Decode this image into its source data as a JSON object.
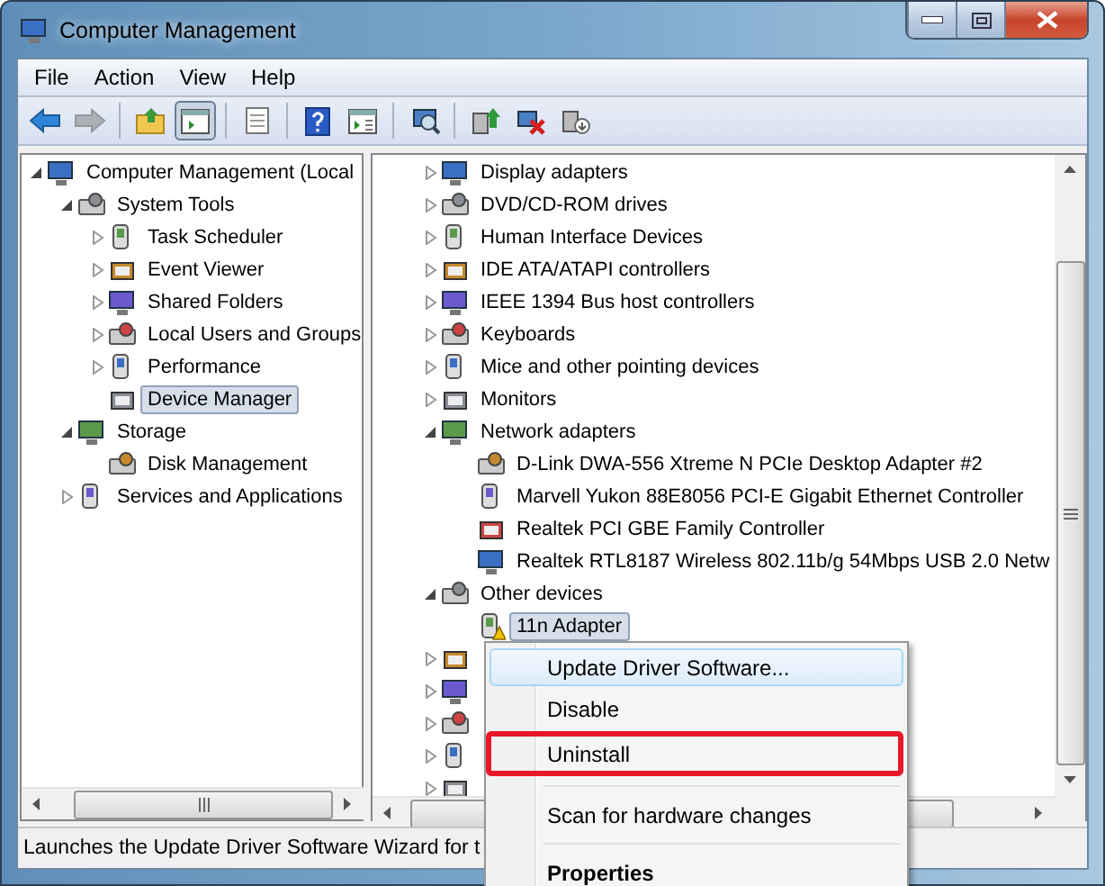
{
  "window": {
    "title": "Computer Management"
  },
  "menu_bar": [
    "File",
    "Action",
    "View",
    "Help"
  ],
  "toolbar": [
    {
      "kind": "back",
      "pressed": false,
      "disabled": false
    },
    {
      "kind": "forward",
      "pressed": false,
      "disabled": true
    },
    {
      "kind": "sep"
    },
    {
      "kind": "up",
      "pressed": false,
      "disabled": false
    },
    {
      "kind": "tree",
      "pressed": true,
      "disabled": false
    },
    {
      "kind": "sep"
    },
    {
      "kind": "sheet",
      "pressed": false,
      "disabled": false
    },
    {
      "kind": "sep"
    },
    {
      "kind": "help",
      "pressed": false,
      "disabled": false
    },
    {
      "kind": "pane",
      "pressed": false,
      "disabled": false
    },
    {
      "kind": "sep"
    },
    {
      "kind": "scan",
      "pressed": false,
      "disabled": false
    },
    {
      "kind": "sep"
    },
    {
      "kind": "update",
      "pressed": false,
      "disabled": false
    },
    {
      "kind": "uninstall",
      "pressed": false,
      "disabled": false
    },
    {
      "kind": "disable",
      "pressed": false,
      "disabled": false
    }
  ],
  "navigation_tree": [
    {
      "label": "Computer Management (Local",
      "expanded": true,
      "selected": false,
      "children": [
        {
          "label": "System Tools",
          "expanded": true,
          "selected": false,
          "children": [
            {
              "label": "Task Scheduler",
              "expanded": false,
              "selected": false
            },
            {
              "label": "Event Viewer",
              "expanded": false,
              "selected": false
            },
            {
              "label": "Shared Folders",
              "expanded": false,
              "selected": false
            },
            {
              "label": "Local Users and Groups",
              "expanded": false,
              "selected": false
            },
            {
              "label": "Performance",
              "expanded": false,
              "selected": false
            },
            {
              "label": "Device Manager",
              "selected": true
            }
          ]
        },
        {
          "label": "Storage",
          "expanded": true,
          "selected": false,
          "children": [
            {
              "label": "Disk Management",
              "selected": false
            }
          ]
        },
        {
          "label": "Services and Applications",
          "expanded": false,
          "selected": false
        }
      ]
    }
  ],
  "device_tree": [
    {
      "label": "Display adapters",
      "expanded": false,
      "selected": false
    },
    {
      "label": "DVD/CD-ROM drives",
      "expanded": false,
      "selected": false
    },
    {
      "label": "Human Interface Devices",
      "expanded": false,
      "selected": false
    },
    {
      "label": "IDE ATA/ATAPI controllers",
      "expanded": false,
      "selected": false
    },
    {
      "label": "IEEE 1394 Bus host controllers",
      "expanded": false,
      "selected": false
    },
    {
      "label": "Keyboards",
      "expanded": false,
      "selected": false
    },
    {
      "label": "Mice and other pointing devices",
      "expanded": false,
      "selected": false
    },
    {
      "label": "Monitors",
      "expanded": false,
      "selected": false
    },
    {
      "label": "Network adapters",
      "expanded": true,
      "selected": false,
      "children": [
        {
          "label": "D-Link DWA-556 Xtreme N PCIe Desktop Adapter #2",
          "selected": false
        },
        {
          "label": "Marvell Yukon 88E8056 PCI-E Gigabit Ethernet Controller",
          "selected": false
        },
        {
          "label": "Realtek PCI GBE Family Controller",
          "selected": false
        },
        {
          "label": "Realtek RTL8187 Wireless 802.11b/g 54Mbps USB 2.0 Netw",
          "selected": false
        }
      ]
    },
    {
      "label": "Other devices",
      "expanded": true,
      "selected": false,
      "children": [
        {
          "label": "11n Adapter",
          "selected": true
        }
      ]
    },
    {
      "expanded": false
    },
    {
      "expanded": false
    },
    {
      "expanded": false
    },
    {
      "expanded": false
    },
    {
      "expanded": false
    }
  ],
  "context_menu": [
    {
      "kind": "item",
      "label": "Update Driver Software...",
      "selected": true,
      "default": false,
      "outlined": false
    },
    {
      "kind": "item",
      "label": "Disable",
      "selected": false,
      "default": false,
      "outlined": false
    },
    {
      "kind": "item",
      "label": "Uninstall",
      "selected": false,
      "default": false,
      "outlined": true
    },
    {
      "kind": "separator"
    },
    {
      "kind": "item",
      "label": "Scan for hardware changes",
      "selected": false,
      "default": false,
      "outlined": false
    },
    {
      "kind": "separator"
    },
    {
      "kind": "item",
      "label": "Properties",
      "selected": false,
      "default": true,
      "outlined": false
    }
  ],
  "status_bar": "Launches the Update Driver Software Wizard for t"
}
